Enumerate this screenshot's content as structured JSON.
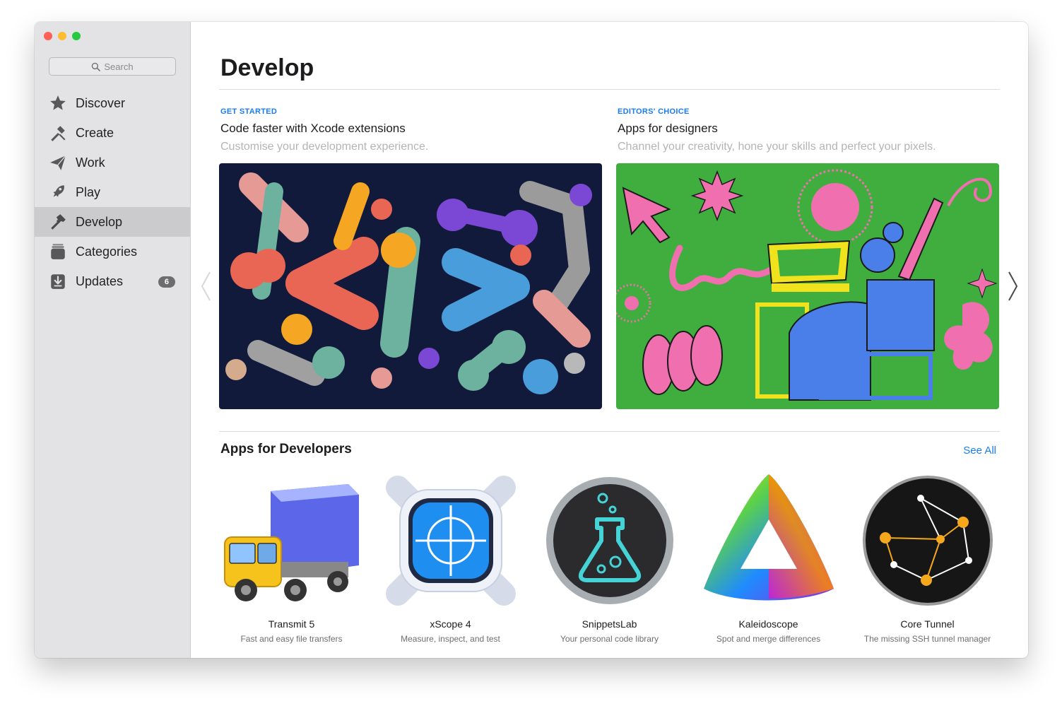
{
  "window": {
    "traffic_lights": {
      "close": "#fe5f57",
      "minimize": "#febc2e",
      "zoom": "#28c840"
    }
  },
  "sidebar": {
    "search": {
      "placeholder": "Search"
    },
    "items": [
      {
        "label": "Discover",
        "icon": "star-icon"
      },
      {
        "label": "Create",
        "icon": "hammer-brush-icon"
      },
      {
        "label": "Work",
        "icon": "paper-plane-icon"
      },
      {
        "label": "Play",
        "icon": "rocket-icon"
      },
      {
        "label": "Develop",
        "icon": "hammer-icon",
        "active": true
      },
      {
        "label": "Categories",
        "icon": "stack-icon"
      },
      {
        "label": "Updates",
        "icon": "download-icon",
        "badge": "6"
      }
    ]
  },
  "main": {
    "title": "Develop",
    "features": [
      {
        "kicker": "GET STARTED",
        "title": "Code faster with Xcode extensions",
        "subtitle": "Customise your development experience.",
        "art": "code-brackets-illustration"
      },
      {
        "kicker": "EDITORS' CHOICE",
        "title": "Apps for designers",
        "subtitle": "Channel your creativity, hone your skills and perfect your pixels.",
        "art": "designer-illustration"
      }
    ],
    "section": {
      "title": "Apps for Developers",
      "see_all": "See All",
      "apps": [
        {
          "name": "Transmit 5",
          "desc": "Fast and easy file transfers",
          "icon": "truck-icon"
        },
        {
          "name": "xScope 4",
          "desc": "Measure, inspect, and test",
          "icon": "crosshair-icon"
        },
        {
          "name": "SnippetsLab",
          "desc": "Your personal code library",
          "icon": "flask-icon"
        },
        {
          "name": "Kaleidoscope",
          "desc": "Spot and merge differences",
          "icon": "prism-icon"
        },
        {
          "name": "Core Tunnel",
          "desc": "The missing SSH tunnel manager",
          "icon": "constellation-icon"
        }
      ]
    }
  },
  "colors": {
    "accent": "#1a7cf5",
    "sidebar_bg": "#e3e3e5",
    "active_item": "#cbcbcd"
  }
}
